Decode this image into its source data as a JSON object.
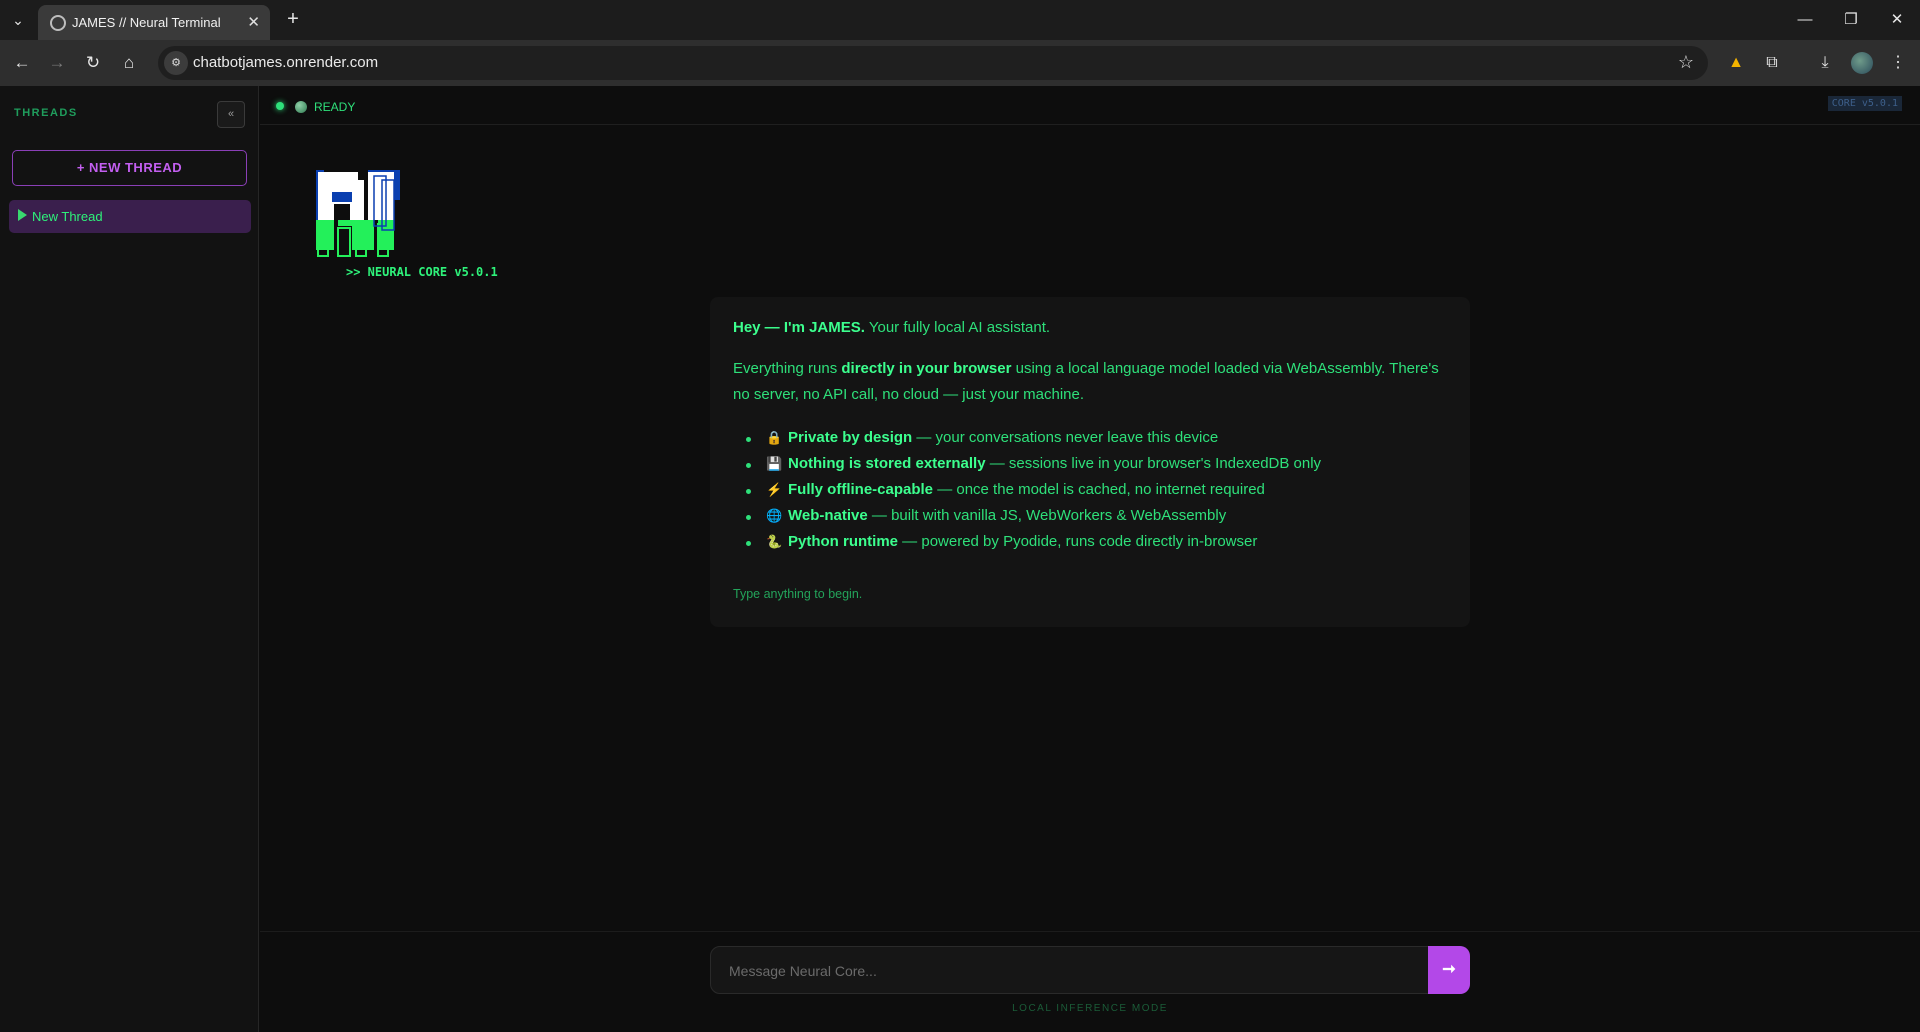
{
  "browser": {
    "tab_title": "JAMES // Neural Terminal",
    "tab_close": "✕",
    "new_tab": "+",
    "tab_list": "⌄",
    "url": "chatbotjames.onrender.com",
    "nav_back": "←",
    "nav_forward": "→",
    "nav_reload": "↻",
    "nav_home": "⌂",
    "star": "☆",
    "site_info": "⚙",
    "win_minimize": "—",
    "win_restore": "❐",
    "win_close": "✕",
    "drive_icon": "▲",
    "extensions_icon": "⧉",
    "download_icon": "⤓",
    "menu_icon": "⋮"
  },
  "sidebar": {
    "title": "THREADS",
    "collapse_label": "«",
    "new_thread_label": "+ NEW THREAD",
    "threads": [
      {
        "label": "New Thread"
      }
    ]
  },
  "status": {
    "label": "READY",
    "core_badge": "CORE v5.0.1"
  },
  "logo": {
    "caption": ">> NEURAL CORE v5.0.1"
  },
  "welcome": {
    "greeting_bold": "Hey — I'm JAMES.",
    "greeting_rest": " Your fully local AI assistant.",
    "para_start": "Everything runs ",
    "para_bold": "directly in your browser",
    "para_end": " using a local language model loaded via WebAssembly. There's",
    "para_line2": "no server, no API call, no cloud — just your machine.",
    "features": [
      {
        "icon": "🔒",
        "title": "Private by design",
        "desc": " — your conversations never leave this device"
      },
      {
        "icon": "💾",
        "title": "Nothing is stored externally",
        "desc": " — sessions live in your browser's IndexedDB only"
      },
      {
        "icon": "⚡",
        "title": "Fully offline-capable",
        "desc": " — once the model is cached, no internet required"
      },
      {
        "icon": "🌐",
        "title": "Web-native",
        "desc": " — built with vanilla JS, WebWorkers & WebAssembly"
      },
      {
        "icon": "🐍",
        "title": "Python runtime",
        "desc": " — powered by Pyodide, runs code directly in-browser"
      }
    ],
    "hint": "Type anything to begin."
  },
  "composer": {
    "placeholder": "Message Neural Core...",
    "send_label": "➞",
    "footer": "LOCAL INFERENCE MODE"
  },
  "colors": {
    "accent_green": "#2ee07a",
    "accent_purple": "#b348e8",
    "background": "#0d0d0d"
  }
}
